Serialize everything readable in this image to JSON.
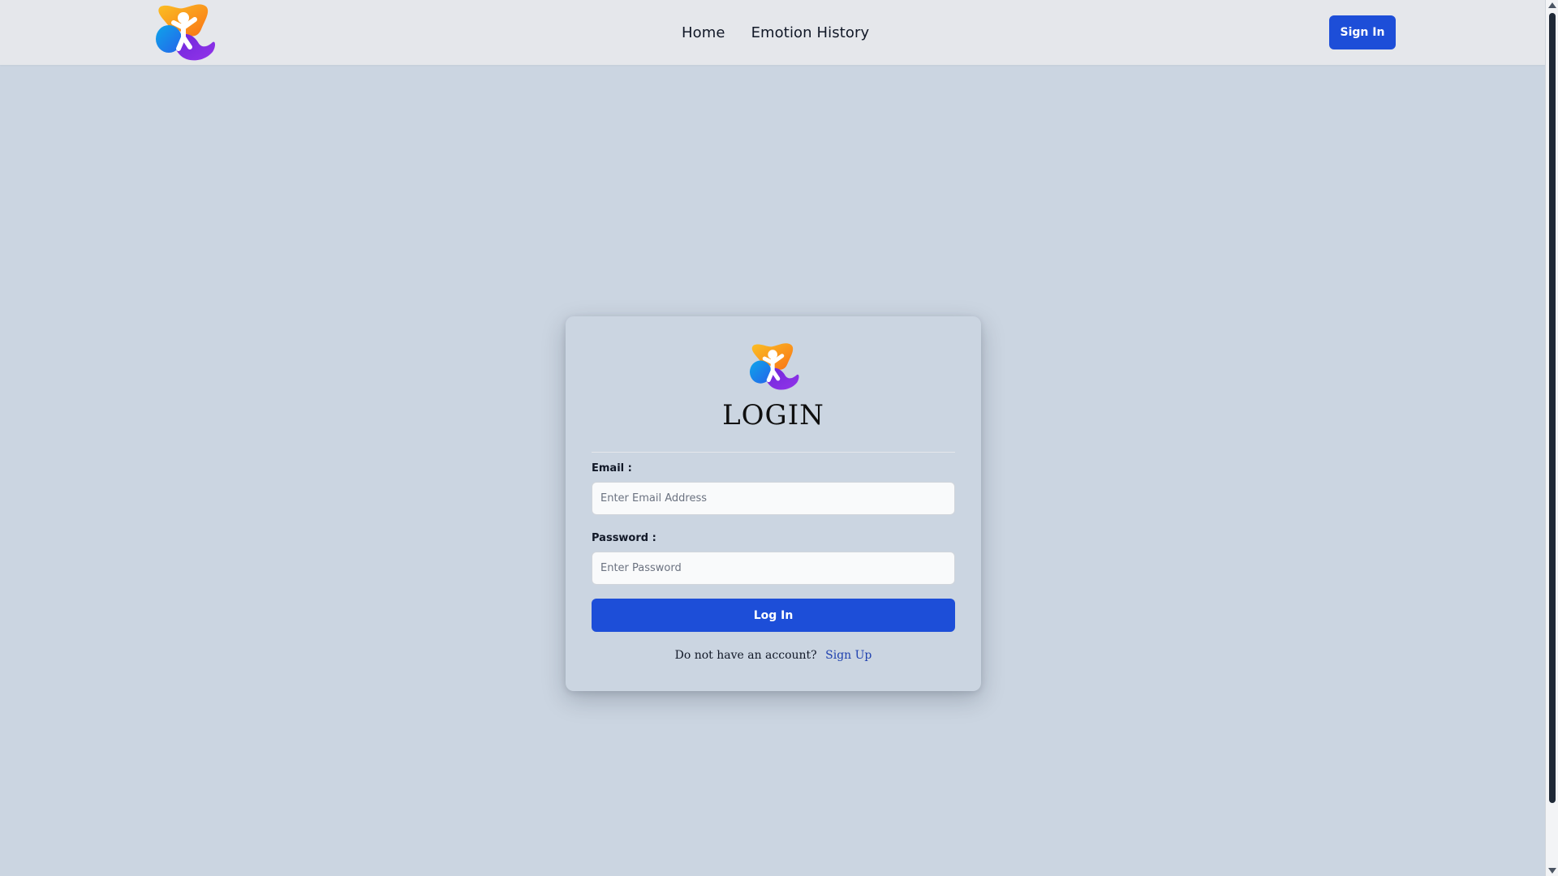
{
  "header": {
    "logo_icon": "app-logo-icon",
    "nav": [
      {
        "label": "Home"
      },
      {
        "label": "Emotion History"
      }
    ],
    "signin_label": "Sign In"
  },
  "login": {
    "logo_icon": "app-logo-icon",
    "title": "LOGIN",
    "email_label": "Email :",
    "email_placeholder": "Enter Email Address",
    "email_value": "",
    "password_label": "Password :",
    "password_placeholder": "Enter Password",
    "password_value": "",
    "submit_label": "Log In",
    "signup_prompt": "Do not have an account?",
    "signup_link": "Sign Up"
  },
  "colors": {
    "page_bg": "#cbd5e1",
    "navbar_bg": "#e5e7eb",
    "primary": "#1d4ed8",
    "link": "#1e40af"
  }
}
